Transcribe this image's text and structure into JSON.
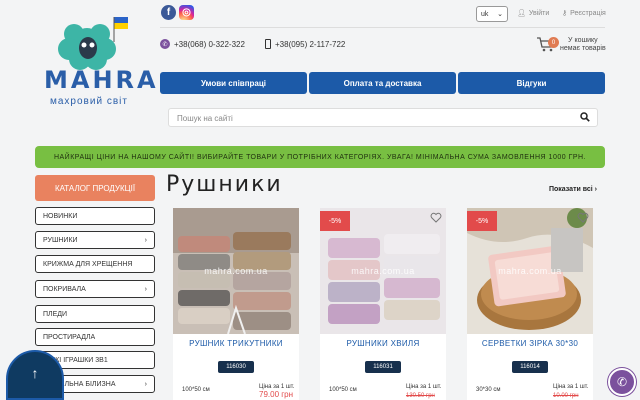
{
  "header": {
    "logo_text": "MAHRA",
    "logo_sub": "махровий світ",
    "social": {
      "facebook": "f",
      "instagram": "◎"
    },
    "language": "uk",
    "login": "Увійти",
    "register": "Реєстрація",
    "phones": [
      "+38(068) 0-322-322",
      "+38(095) 2-117-722"
    ],
    "cart": {
      "count": "0",
      "line1": "У кошику",
      "line2": "немає товарів"
    }
  },
  "nav": {
    "items": [
      "Умови співпраці",
      "Оплата та доставка",
      "Відгуки"
    ]
  },
  "search": {
    "placeholder": "Пошук на сайті"
  },
  "banner": {
    "text": "НАЙКРАЩІ ЦІНИ НА НАШОМУ САЙТІ! ВИБИРАЙТЕ ТОВАРИ У ПОТРІБНИХ КАТЕГОРІЯХ. УВАГА! МІНІМАЛЬНА СУМА ЗАМОВЛЕННЯ 1000 ГРН."
  },
  "sidebar": {
    "catalog_label": "КАТАЛОГ ПРОДУКЦІЇ",
    "items": [
      {
        "label": "НОВИНКИ",
        "arrow": ""
      },
      {
        "label": "РУШНИКИ",
        "arrow": "›"
      },
      {
        "label": "КРИЖМА ДЛЯ ХРЕЩЕННЯ",
        "arrow": ""
      },
      {
        "label": "ПОКРИВАЛА",
        "arrow": "›"
      },
      {
        "label": "ПЛЕДИ",
        "arrow": ""
      },
      {
        "label": "ПРОСТИРАДЛА",
        "arrow": ""
      },
      {
        "label": "М'ЯКІ ІГРАШКИ 3В1",
        "arrow": ""
      },
      {
        "label": "ПОСТІЛЬНА БІЛИЗНА",
        "arrow": "›"
      }
    ]
  },
  "main": {
    "title": "Рушники",
    "show_all": "Показати всі",
    "watermark": "mahra.com.ua",
    "price_label": "Ціна за 1 шт.",
    "products": [
      {
        "name": "РУШНИК ТРИКУТНИКИ",
        "code": "116030",
        "discount": "",
        "size": "100*50 см",
        "old_price": "",
        "new_price": "79.00 грн"
      },
      {
        "name": "РУШНИКИ ХВИЛЯ",
        "code": "116031",
        "discount": "-5%",
        "size": "100*50 см",
        "old_price": "130.50 грн",
        "new_price": ""
      },
      {
        "name": "СЕРВЕТКИ ЗІРКА 30*30",
        "code": "116014",
        "discount": "-5%",
        "size": "30*30 см",
        "old_price": "10.00 грн",
        "new_price": ""
      }
    ]
  },
  "floating": {
    "up": "↑",
    "viber": "✆"
  },
  "colors": {
    "brand_blue": "#1c5aa8",
    "accent_orange": "#e9825f",
    "banner_green": "#78bf42",
    "discount_red": "#e24b4b"
  }
}
